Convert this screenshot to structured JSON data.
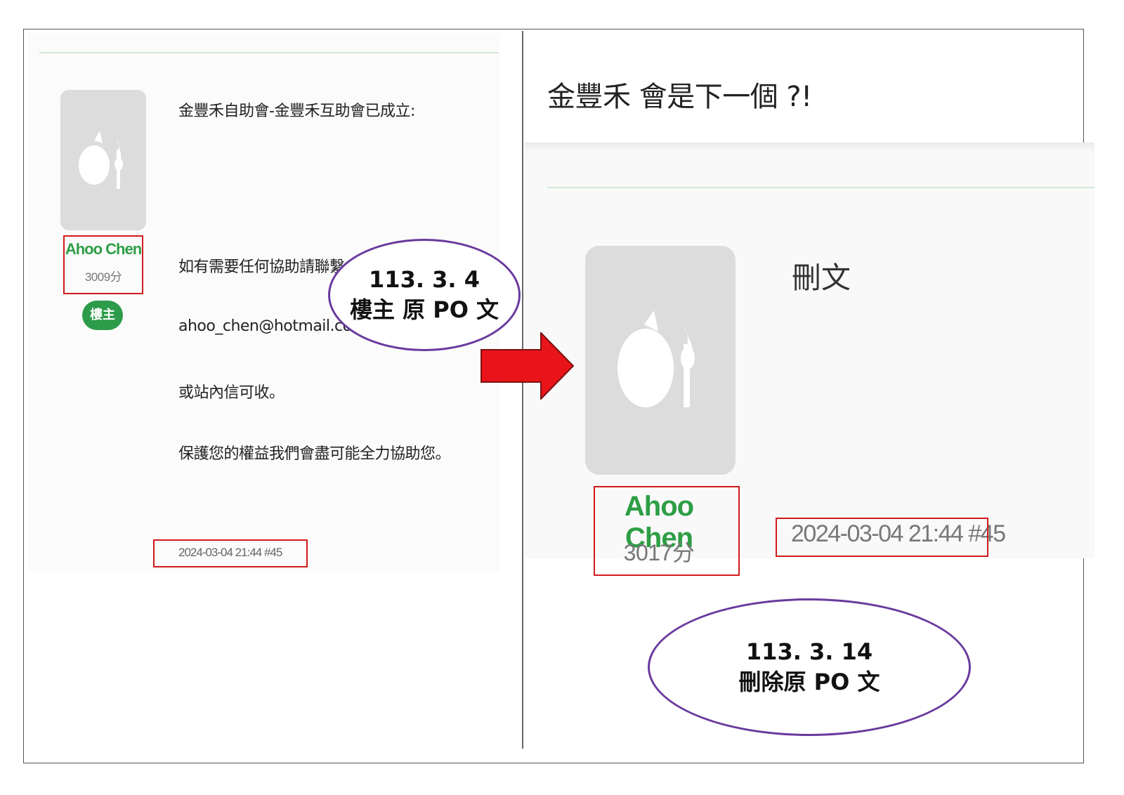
{
  "left_post": {
    "user": {
      "name": "Ahoo Chen",
      "points": "3009分",
      "badge": "樓主"
    },
    "lines": [
      "金豐禾自助會-金豐禾互助會已成立:",
      "如有需要任何協助請聯繫:",
      "ahoo_chen@hotmail.com",
      "或站內信可收。",
      "保護您的權益我們會盡可能全力協助您。"
    ],
    "timestamp": "2024-03-04 21:44 #45"
  },
  "right_post": {
    "title": "金豐禾 會是下一個 ?!",
    "user": {
      "name": "Ahoo Chen",
      "points": "3017分"
    },
    "content": "刪文",
    "timestamp": "2024-03-04 21:44 #45"
  },
  "annotations": {
    "left": {
      "line1": "113. 3. 4",
      "line2": "樓主  原 PO 文"
    },
    "right": {
      "line1": "113. 3. 14",
      "line2": "刪除原 PO 文"
    }
  },
  "colors": {
    "username": "#2e9e45",
    "highlight_box": "#d11a1a",
    "ellipse_border": "#6a3a9e",
    "arrow": "#e8141a",
    "badge": "#2c9b4a"
  },
  "icons": {
    "avatar": "default-avatar-icon",
    "arrow": "right-arrow-icon"
  }
}
